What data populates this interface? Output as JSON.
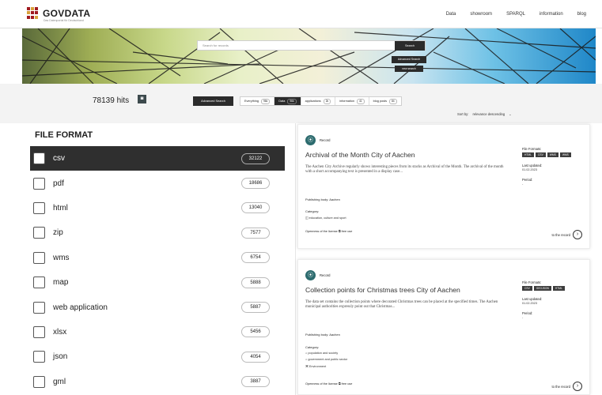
{
  "header": {
    "logo_text": "GOVDATA",
    "logo_subtitle": "Das Datenportal für Deutschland",
    "nav": [
      "Data",
      "showroom",
      "SPARQL",
      "information",
      "blog"
    ]
  },
  "hero": {
    "search_placeholder": "Search for records",
    "search_button": "Search",
    "advanced_search": "Advanced Search",
    "new_search": "new search"
  },
  "results": {
    "hits": "78139 hits",
    "advanced_search": "Advanced Search",
    "tabs": [
      {
        "label": "Everything",
        "count": "96k",
        "active": false
      },
      {
        "label": "Data",
        "count": "96k",
        "active": true
      },
      {
        "label": "applications",
        "count": "2k",
        "active": false
      },
      {
        "label": "information",
        "count": "41",
        "active": false
      },
      {
        "label": "blog posts",
        "count": "84",
        "active": false
      }
    ],
    "sort_label": "Sort by:",
    "sort_value": "relevance descending"
  },
  "filter": {
    "title": "FILE FORMAT",
    "items": [
      {
        "label": "csv",
        "count": "32122",
        "active": true
      },
      {
        "label": "pdf",
        "count": "18686",
        "active": false
      },
      {
        "label": "html",
        "count": "13040",
        "active": false
      },
      {
        "label": "zip",
        "count": "7577",
        "active": false
      },
      {
        "label": "wms",
        "count": "6754",
        "active": false
      },
      {
        "label": "map",
        "count": "5888",
        "active": false
      },
      {
        "label": "web application",
        "count": "5887",
        "active": false
      },
      {
        "label": "xlsx",
        "count": "5456",
        "active": false
      },
      {
        "label": "json",
        "count": "4054",
        "active": false
      },
      {
        "label": "gml",
        "count": "3887",
        "active": false
      }
    ]
  },
  "cards": [
    {
      "type": "Record",
      "title": "Archival of the Month City of Aachen",
      "description": "The Aachen City Archive regularly shows interesting pieces from its stacks as Archival of the Month. The archival of the month with a short accompanying text is presented in a display case...",
      "publishing_body": "Publishing body: Aachen",
      "category_label": "Category:",
      "categories": [
        "education, culture and sport"
      ],
      "license": "Openness of the license",
      "license_value": "free use",
      "to_record": "to the record",
      "file_formats_label": "File Formats:",
      "file_formats": [
        "HTML",
        "CSV",
        "WMS",
        "WMS"
      ],
      "last_updated_label": "Last updated:",
      "last_updated": "01.02.2023",
      "period_label": "Period:",
      "period": "-"
    },
    {
      "type": "Record",
      "title": "Collection points for Christmas trees City of Aachen",
      "description": "The data set contains the collection points where decorated Christmas trees can be placed at the specified times. The Aachen municipal authorities expressly point out that Christmas...",
      "publishing_body": "Publishing body: Aachen",
      "category_label": "Category:",
      "categories": [
        "population and society",
        "government and public sector",
        "Environment"
      ],
      "license": "Openness of the license",
      "license_value": "free use",
      "to_record": "to the record",
      "file_formats_label": "File Formats:",
      "file_formats": [
        "CSV",
        "GEOJSON",
        "HTML"
      ],
      "last_updated_label": "Last updated:",
      "last_updated": "01.02.2023",
      "period_label": "Period:",
      "period": "-"
    }
  ]
}
